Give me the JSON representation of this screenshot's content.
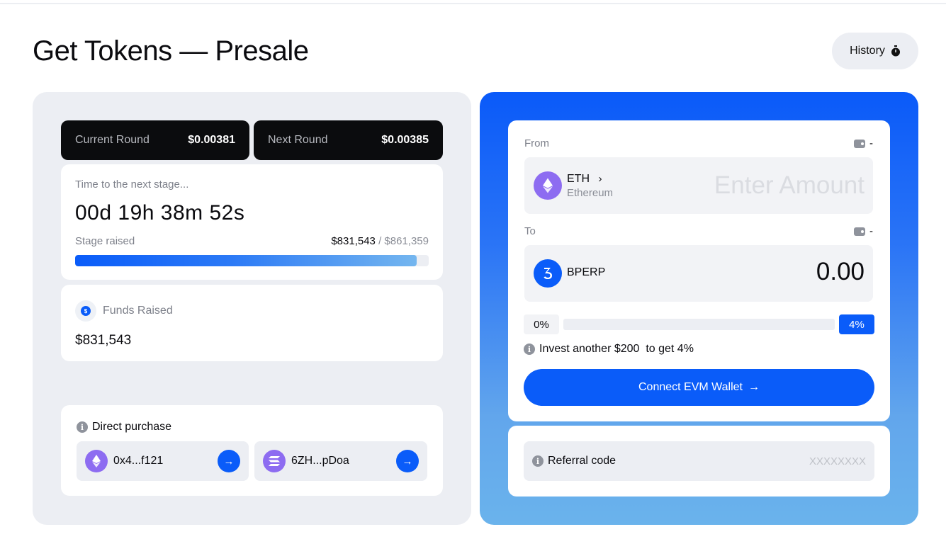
{
  "header": {
    "title": "Get Tokens — Presale",
    "history_label": "History",
    "history_icon": "stopwatch-icon"
  },
  "rounds": {
    "current_label": "Current Round",
    "current_price": "$0.00381",
    "next_label": "Next Round",
    "next_price": "$0.00385"
  },
  "timer": {
    "caption": "Time to the next stage...",
    "value": "00d 19h 38m 52s",
    "stage_label": "Stage raised",
    "stage_raised": "$831,543",
    "stage_separator": " / ",
    "stage_goal": "$861,359",
    "progress_fraction": 0.965
  },
  "funds": {
    "icon": "dollar-coin-icon",
    "label": "Funds Raised",
    "value": "$831,543"
  },
  "direct_purchase": {
    "title": "Direct purchase",
    "addresses": [
      {
        "icon": "ethereum-icon",
        "text": "0x4...f121"
      },
      {
        "icon": "solana-icon",
        "text": "6ZH...pDoa"
      }
    ]
  },
  "swap": {
    "from_label": "From",
    "from_balance": "-",
    "from_token_symbol": "ETH",
    "from_token_chevron": "›",
    "from_token_name": "Ethereum",
    "from_amount_placeholder": "Enter Amount",
    "to_label": "To",
    "to_balance": "-",
    "to_token_symbol": "BPERP",
    "to_amount": "0.00",
    "bonus_min": "0%",
    "bonus_max": "4%",
    "invest_note": "Invest another $200  to get 4%",
    "connect_label": "Connect EVM Wallet",
    "connect_arrow": "→"
  },
  "referral": {
    "label": "Referral code",
    "placeholder": "XXXXXXXX"
  },
  "colors": {
    "accent": "#0a5cf9",
    "eth_purple": "#8d6cf1",
    "panel_bg": "#eceef3",
    "dark_card": "#0b0c0e"
  }
}
